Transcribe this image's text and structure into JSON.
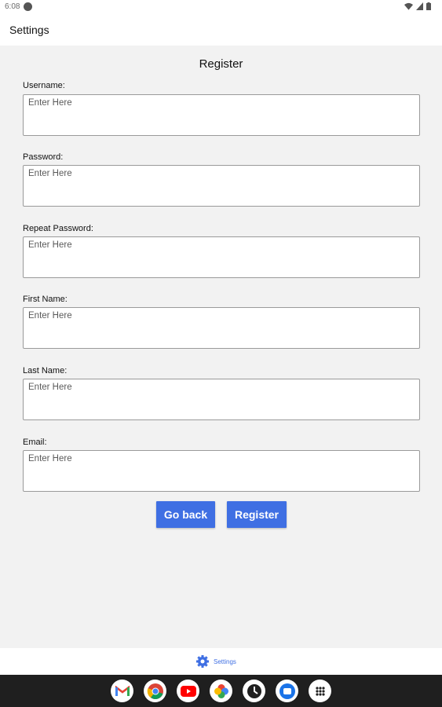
{
  "status_bar": {
    "time": "6:08"
  },
  "app_bar": {
    "title": "Settings"
  },
  "form": {
    "title": "Register",
    "fields": [
      {
        "label": "Username:",
        "placeholder": "Enter Here"
      },
      {
        "label": "Password:",
        "placeholder": "Enter Here"
      },
      {
        "label": "Repeat Password:",
        "placeholder": "Enter Here"
      },
      {
        "label": "First Name:",
        "placeholder": "Enter Here"
      },
      {
        "label": "Last Name:",
        "placeholder": "Enter Here"
      },
      {
        "label": "Email:",
        "placeholder": "Enter Here"
      }
    ],
    "go_back_label": "Go back",
    "register_label": "Register"
  },
  "bottom_nav": {
    "settings_label": "Settings"
  },
  "dock": {
    "apps": [
      "gmail-icon",
      "chrome-icon",
      "youtube-icon",
      "photos-icon",
      "clock-icon",
      "messages-icon",
      "app-drawer-icon"
    ]
  },
  "colors": {
    "accent": "#3f6fe3",
    "background": "#f2f2f2",
    "dock": "#1f1f1f"
  }
}
